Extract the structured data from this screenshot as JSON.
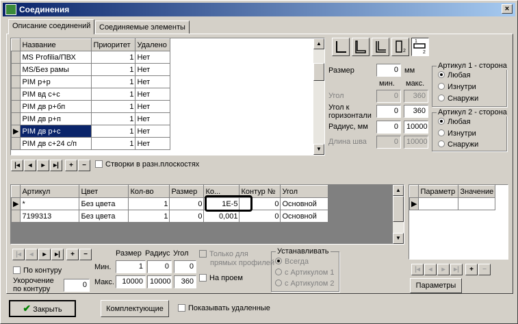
{
  "window": {
    "title": "Соединения",
    "close": "×"
  },
  "tabs": [
    "Описание соединений",
    "Соединяемые элементы"
  ],
  "connections": {
    "columns": [
      "Название",
      "Приоритет",
      "Удалено"
    ],
    "rows": [
      {
        "name": "MS Profilia/ПВХ",
        "priority": "1",
        "deleted": "Нет"
      },
      {
        "name": "MS/Без рамы",
        "priority": "1",
        "deleted": "Нет"
      },
      {
        "name": "PIM р+р",
        "priority": "1",
        "deleted": "Нет"
      },
      {
        "name": "PIM вд с+с",
        "priority": "1",
        "deleted": "Нет"
      },
      {
        "name": "PIM дв р+бп",
        "priority": "1",
        "deleted": "Нет"
      },
      {
        "name": "PIM дв р+п",
        "priority": "1",
        "deleted": "Нет"
      },
      {
        "name": "PIM дв р+с",
        "priority": "1",
        "deleted": "Нет"
      },
      {
        "name": "PIM дв с+24 с/п",
        "priority": "1",
        "deleted": "Нет"
      }
    ],
    "selected_index": 6,
    "checkbox_label": "Створки в разн.плоскостях"
  },
  "params": {
    "size_label": "Размер",
    "size_value": "0",
    "size_unit": "мм",
    "min_label": "мин.",
    "max_label": "макс.",
    "angle_label": "Угол",
    "angle_min": "0",
    "angle_max": "360",
    "horiz_label_1": "Угол к",
    "horiz_label_2": "горизонтали",
    "horiz_min": "0",
    "horiz_max": "360",
    "radius_label": "Радиус, мм",
    "radius_min": "0",
    "radius_max": "10000",
    "seam_label": "Длина шва",
    "seam_min": "0",
    "seam_max": "10000"
  },
  "side1": {
    "title": "Артикул 1 - сторона",
    "options": [
      "Любая",
      "Изнутри",
      "Снаружи"
    ]
  },
  "side2": {
    "title": "Артикул 2 - сторона",
    "options": [
      "Любая",
      "Изнутри",
      "Снаружи"
    ]
  },
  "articles": {
    "columns": [
      "Артикул",
      "Цвет",
      "Кол-во",
      "Размер",
      "Ко...",
      "Контур №",
      "Угол"
    ],
    "rows": [
      {
        "art": "*",
        "color": "Без цвета",
        "qty": "1",
        "size": "0",
        "coef": "1E-5",
        "contour": "0",
        "angle": "Основной"
      },
      {
        "art": "7199313",
        "color": "Без цвета",
        "qty": "1",
        "size": "0",
        "coef": "0,001",
        "contour": "0",
        "angle": "Основной"
      }
    ]
  },
  "paramgrid": {
    "columns": [
      "Параметр",
      "Значение"
    ],
    "button": "Параметры"
  },
  "bottom": {
    "size_label": "Размер",
    "radius_label": "Радиус",
    "angle_label": "Угол",
    "min_label": "Мин.",
    "max_label": "Макс.",
    "min_size": "1",
    "min_radius": "0",
    "min_angle": "0",
    "max_size": "10000",
    "max_radius": "10000",
    "max_angle": "360",
    "by_contour": "По контуру",
    "shorten_1": "Укорочение",
    "shorten_2": "по контуру",
    "shorten_value": "0",
    "straight_1": "Только для",
    "straight_2": "прямых профилей",
    "opening": "На проем",
    "install_title": "Устанавливать",
    "install_options": [
      "Всегда",
      "с Артикулом 1",
      "с Артикулом 2"
    ]
  },
  "footer": {
    "close": "Закрыть",
    "kit": "Комплектующие",
    "show_deleted": "Показывать удаленные"
  }
}
